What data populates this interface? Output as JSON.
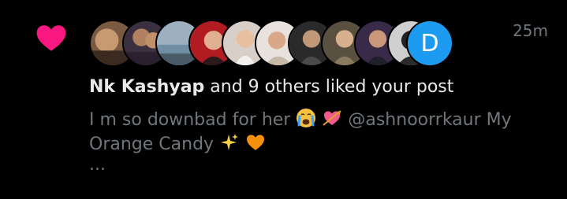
{
  "notification": {
    "timestamp": "25m",
    "actor_name": "Nk Kashyap",
    "action_text": "and 9 others liked your post",
    "post_text_part1": "I m so downbad for her",
    "post_text_part2": "@ashnoorrkaur My Orange Candy",
    "ellipsis": "...",
    "avatar_letter": "D",
    "accent_color": "#f91880",
    "avatar_letter_bg": "#1d9bf0"
  },
  "icons": {
    "like": "heart-icon",
    "emoji_1": "crying-face-emoji",
    "emoji_2": "heart-with-arrow-emoji",
    "emoji_3": "sparkles-emoji",
    "emoji_4": "orange-heart-emoji"
  }
}
